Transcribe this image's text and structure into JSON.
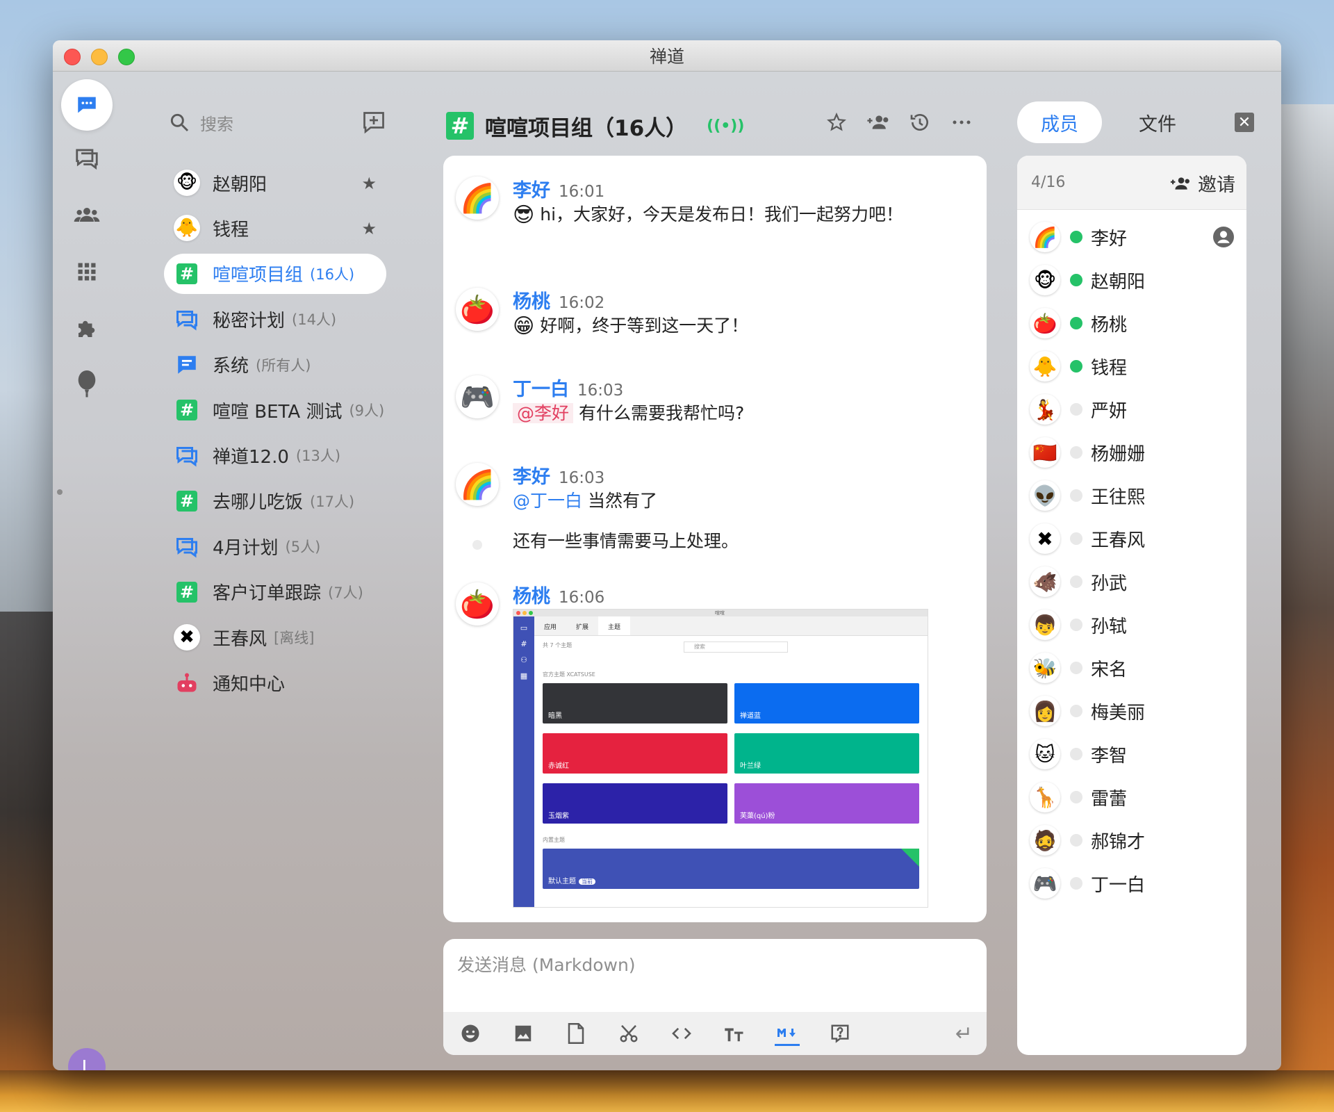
{
  "window": {
    "title": "禅道"
  },
  "chat_list": {
    "search_placeholder": "搜索",
    "items": [
      {
        "name": "赵朝阳",
        "count": "",
        "icon": "monkey-avatar",
        "emoji": "🐵",
        "starred": true
      },
      {
        "name": "钱程",
        "count": "",
        "icon": "chick-avatar",
        "emoji": "🐥",
        "starred": true
      },
      {
        "name": "喧喧项目组",
        "count": "(16人)",
        "icon": "hash-icon",
        "emoji": "#",
        "active": true
      },
      {
        "name": "秘密计划",
        "count": "(14人)",
        "icon": "discussion-icon",
        "emoji": "💬"
      },
      {
        "name": "系统",
        "count": "(所有人)",
        "icon": "message-icon",
        "emoji": "🗨"
      },
      {
        "name": "喧喧 BETA 测试",
        "count": "(9人)",
        "icon": "hash-icon",
        "emoji": "#"
      },
      {
        "name": "禅道12.0",
        "count": "(13人)",
        "icon": "discussion-icon",
        "emoji": "💬"
      },
      {
        "name": "去哪儿吃饭",
        "count": "(17人)",
        "icon": "hash-icon",
        "emoji": "#"
      },
      {
        "name": "4月计划",
        "count": "(5人)",
        "icon": "discussion-icon",
        "emoji": "💬"
      },
      {
        "name": "客户订单跟踪",
        "count": "(7人)",
        "icon": "hash-icon",
        "emoji": "#"
      },
      {
        "name": "王春风",
        "count": "[离线]",
        "icon": "x-avatar",
        "emoji": "✖"
      },
      {
        "name": "通知中心",
        "count": "",
        "icon": "robot-icon",
        "emoji": "🤖"
      }
    ]
  },
  "header": {
    "title": "喧喧项目组（16人）",
    "live": "((•))"
  },
  "messages": [
    {
      "name": "李好",
      "time": "16:01",
      "avatar": "🌈",
      "emoji": "😎",
      "text": "hi，大家好，今天是发布日！我们一起努力吧！"
    },
    {
      "name": "杨桃",
      "time": "16:02",
      "avatar": "🍅",
      "emoji": "😁",
      "text": "好啊，终于等到这一天了！"
    },
    {
      "name": "丁一白",
      "time": "16:03",
      "avatar": "🎮",
      "mention": "@李好",
      "text": "有什么需要我帮忙吗?"
    },
    {
      "name": "李好",
      "time": "16:03",
      "avatar": "🌈",
      "mention": "@丁一白",
      "text": "当然有了",
      "followup": "还有一些事情需要马上处理。"
    },
    {
      "name": "杨桃",
      "time": "16:06",
      "avatar": "🍅"
    }
  ],
  "screenshot": {
    "title": "喧喧",
    "tabs": [
      "应用",
      "扩展",
      "主题"
    ],
    "count_note": "共 7 个主题",
    "search": "搜索",
    "official_label": "官方主题 XCATSUSE",
    "builtin_label": "内置主题",
    "themes": [
      {
        "name": "暗黑",
        "color": "#333438"
      },
      {
        "name": "禅道蓝",
        "color": "#0b6cf0"
      },
      {
        "name": "赤诚红",
        "color": "#e5223f"
      },
      {
        "name": "叶兰绿",
        "color": "#00b48c"
      },
      {
        "name": "玉烟紫",
        "color": "#2c22a8"
      },
      {
        "name": "芙蕖(qú)粉",
        "color": "#9c4fd8"
      }
    ],
    "default_theme": "默认主题",
    "default_badge": "当前"
  },
  "composer": {
    "placeholder": "发送消息 (Markdown)"
  },
  "members_panel": {
    "tab_members": "成员",
    "tab_files": "文件",
    "count": "4/16",
    "invite": "邀请",
    "members": [
      {
        "name": "李好",
        "avatar": "🌈",
        "online": true,
        "admin": true
      },
      {
        "name": "赵朝阳",
        "avatar": "🐵",
        "online": true
      },
      {
        "name": "杨桃",
        "avatar": "🍅",
        "online": true
      },
      {
        "name": "钱程",
        "avatar": "🐥",
        "online": true
      },
      {
        "name": "严妍",
        "avatar": "💃",
        "online": false
      },
      {
        "name": "杨姗姗",
        "avatar": "🇨🇳",
        "online": false
      },
      {
        "name": "王往熙",
        "avatar": "👽",
        "online": false
      },
      {
        "name": "王春风",
        "avatar": "✖",
        "online": false
      },
      {
        "name": "孙武",
        "avatar": "🐗",
        "online": false
      },
      {
        "name": "孙轼",
        "avatar": "👦",
        "online": false
      },
      {
        "name": "宋名",
        "avatar": "🐝",
        "online": false
      },
      {
        "name": "梅美丽",
        "avatar": "👩",
        "online": false
      },
      {
        "name": "李智",
        "avatar": "🐱",
        "online": false
      },
      {
        "name": "雷蕾",
        "avatar": "🦒",
        "online": false
      },
      {
        "name": "郝锦才",
        "avatar": "🧔",
        "online": false
      },
      {
        "name": "丁一白",
        "avatar": "🎮",
        "online": false
      }
    ]
  },
  "user": {
    "initial": "L"
  },
  "colors": {
    "accent": "#2d7ef0",
    "green": "#25c268",
    "mention": "#e23f60"
  }
}
